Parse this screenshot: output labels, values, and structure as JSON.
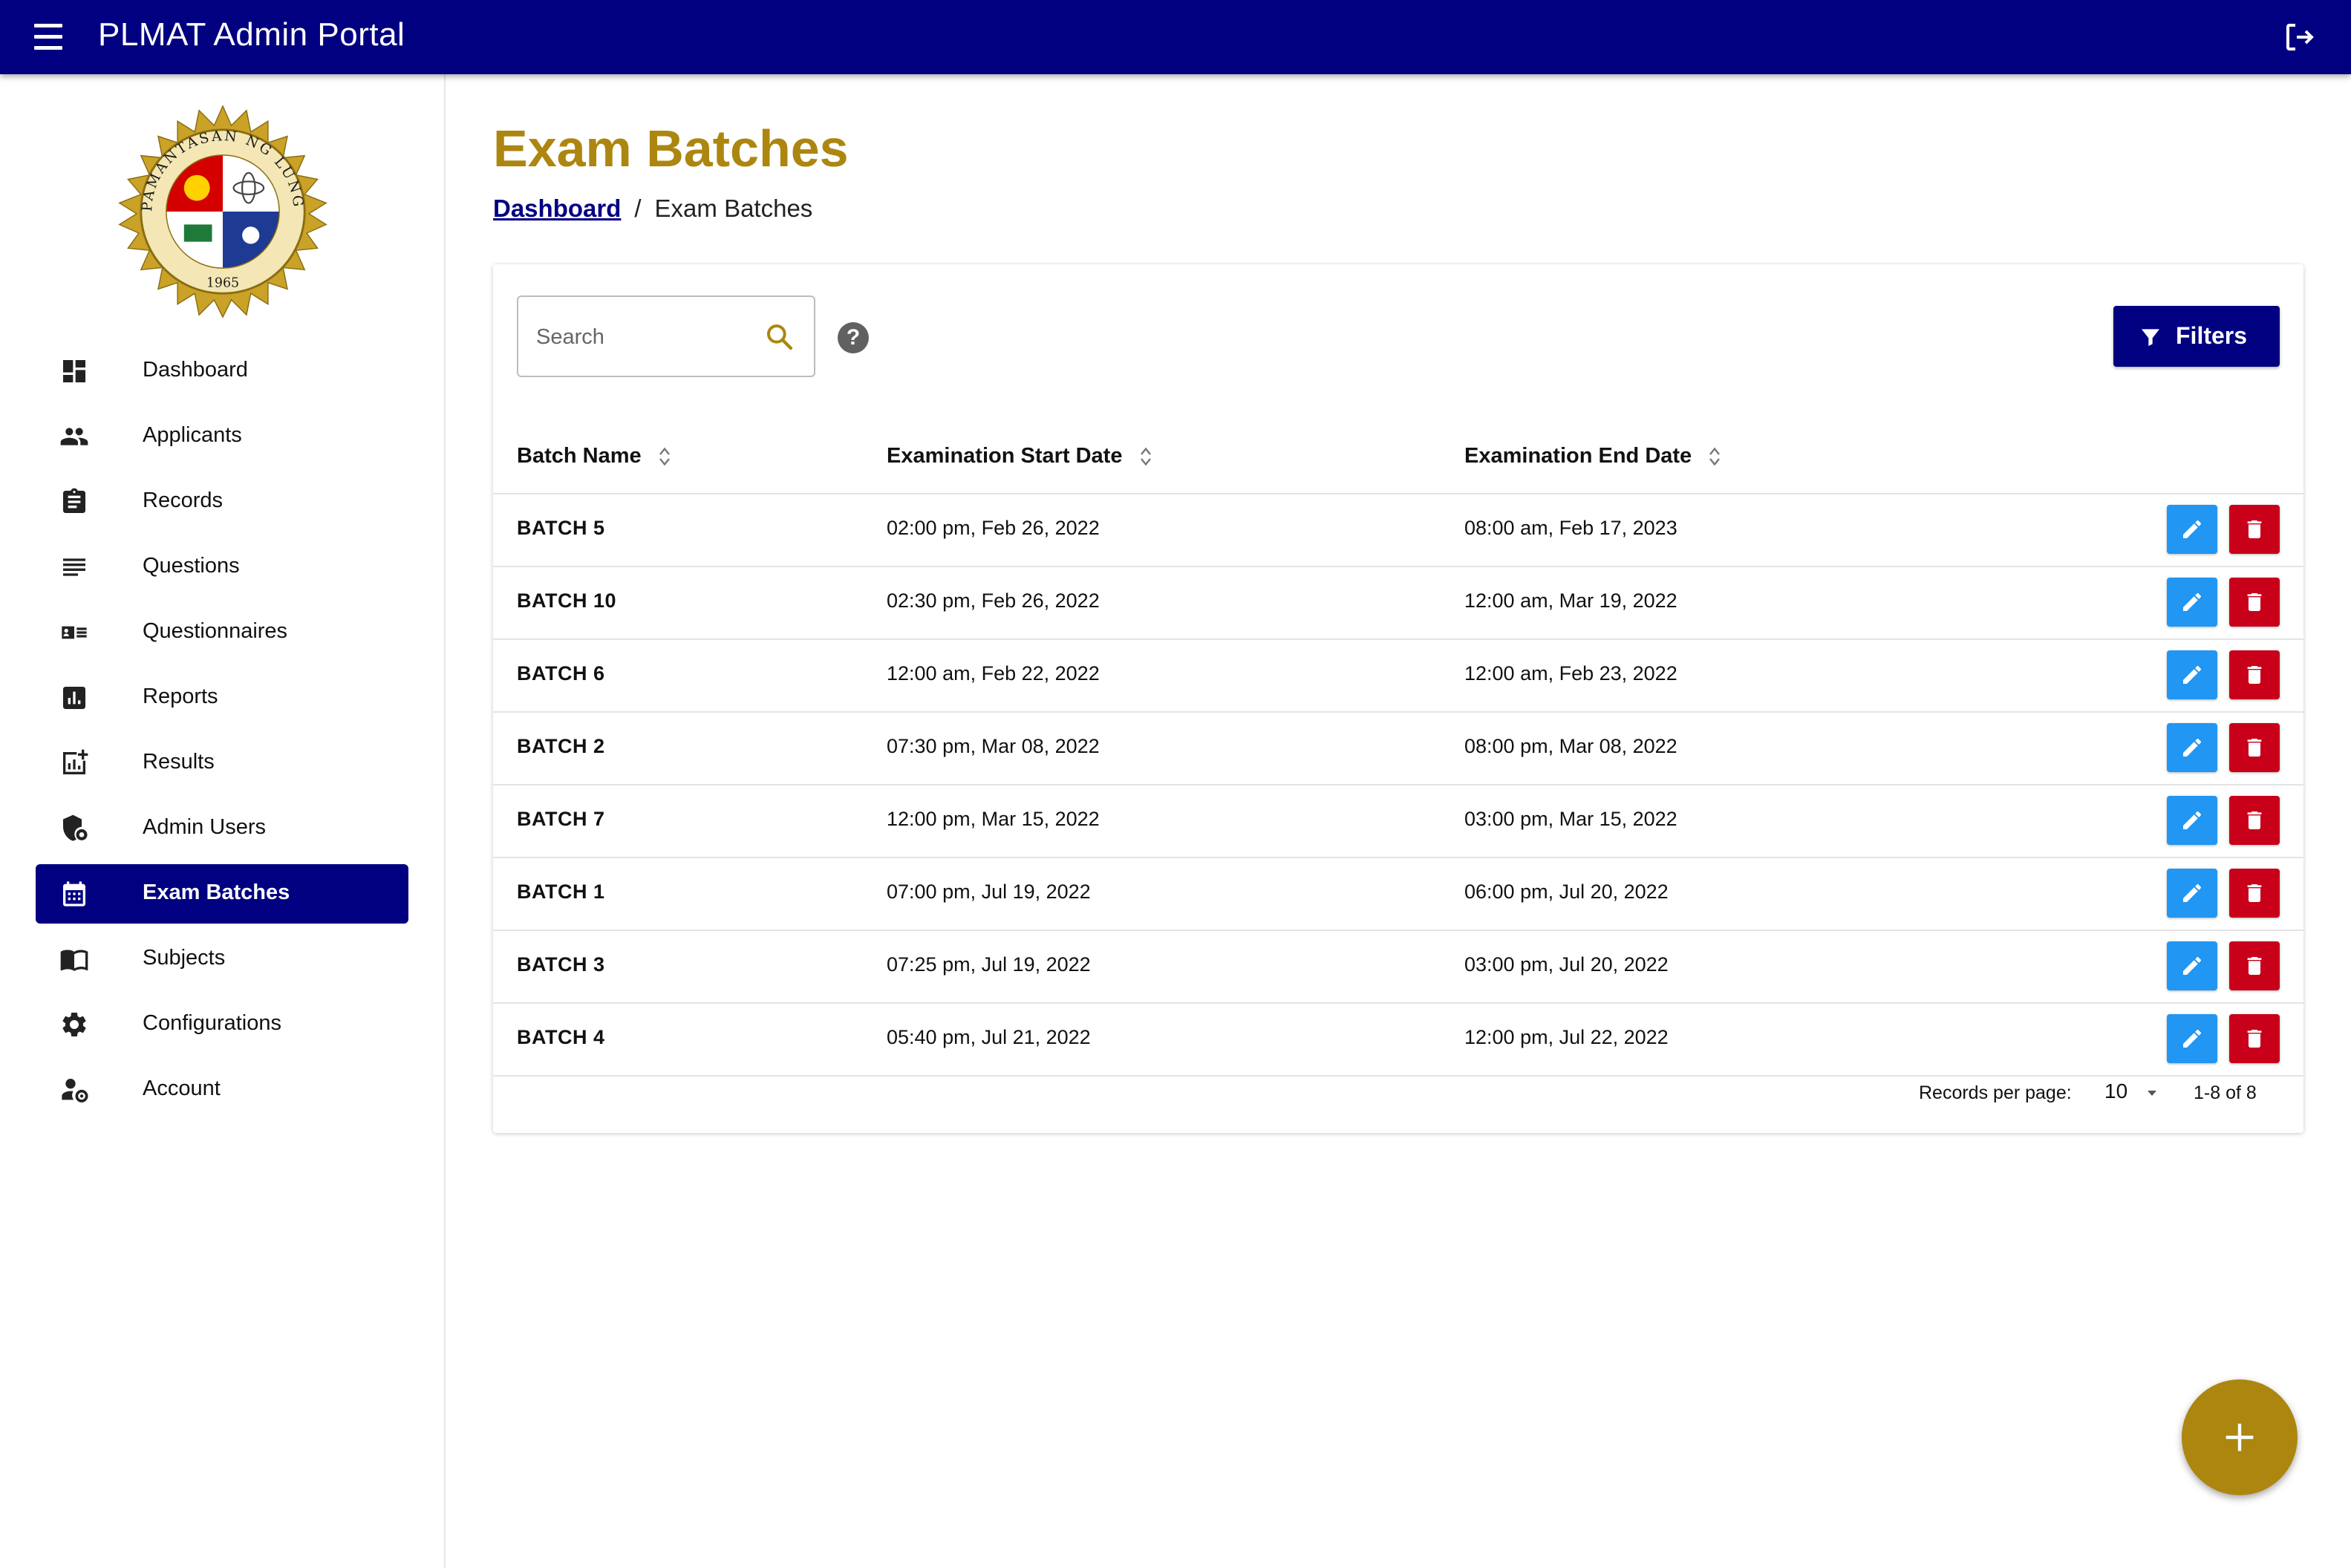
{
  "app": {
    "title": "PLMAT Admin Portal"
  },
  "colors": {
    "navy": "#010080",
    "gold": "#ac860f",
    "edit": "#2196f3",
    "delete": "#c8001a"
  },
  "seal": {
    "text_top": "PAMANTASAN NG LUNGSOD NG MAYNILA",
    "year": "1965"
  },
  "sidebar": {
    "items": [
      {
        "label": "Dashboard",
        "icon": "dashboard-icon"
      },
      {
        "label": "Applicants",
        "icon": "people-icon"
      },
      {
        "label": "Records",
        "icon": "clipboard-icon"
      },
      {
        "label": "Questions",
        "icon": "lines-icon"
      },
      {
        "label": "Questionnaires",
        "icon": "card-list-icon"
      },
      {
        "label": "Reports",
        "icon": "bar-report-icon"
      },
      {
        "label": "Results",
        "icon": "analytics-add-icon"
      },
      {
        "label": "Admin Users",
        "icon": "admin-shield-icon"
      },
      {
        "label": "Exam Batches",
        "icon": "calendar-icon",
        "active": true
      },
      {
        "label": "Subjects",
        "icon": "book-icon"
      },
      {
        "label": "Configurations",
        "icon": "gear-icon"
      },
      {
        "label": "Account",
        "icon": "account-settings-icon"
      }
    ]
  },
  "page": {
    "title": "Exam Batches",
    "breadcrumb": {
      "link": "Dashboard",
      "separator": "/",
      "current": "Exam Batches"
    }
  },
  "toolbar": {
    "search_placeholder": "Search",
    "help": "?",
    "filters_label": "Filters"
  },
  "table": {
    "headers": {
      "name": "Batch Name",
      "start": "Examination Start Date",
      "end": "Examination End Date"
    },
    "rows": [
      {
        "name": "BATCH 5",
        "start": "02:00 pm, Feb 26, 2022",
        "end": "08:00 am, Feb 17, 2023"
      },
      {
        "name": "BATCH 10",
        "start": "02:30 pm, Feb 26, 2022",
        "end": "12:00 am, Mar 19, 2022"
      },
      {
        "name": "BATCH 6",
        "start": "12:00 am, Feb 22, 2022",
        "end": "12:00 am, Feb 23, 2022"
      },
      {
        "name": "BATCH 2",
        "start": "07:30 pm, Mar 08, 2022",
        "end": "08:00 pm, Mar 08, 2022"
      },
      {
        "name": "BATCH 7",
        "start": "12:00 pm, Mar 15, 2022",
        "end": "03:00 pm, Mar 15, 2022"
      },
      {
        "name": "BATCH 1",
        "start": "07:00 pm, Jul 19, 2022",
        "end": "06:00 pm, Jul 20, 2022"
      },
      {
        "name": "BATCH 3",
        "start": "07:25 pm, Jul 19, 2022",
        "end": "03:00 pm, Jul 20, 2022"
      },
      {
        "name": "BATCH 4",
        "start": "05:40 pm, Jul 21, 2022",
        "end": "12:00 pm, Jul 22, 2022"
      }
    ]
  },
  "pagination": {
    "records_per_page_label": "Records per page:",
    "records_per_page": "10",
    "range": "1-8 of 8"
  }
}
